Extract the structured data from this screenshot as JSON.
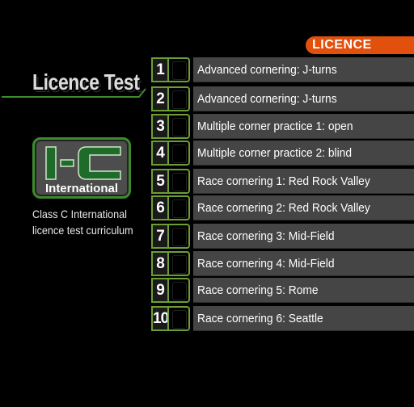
{
  "header": {
    "tab_label": "LICENCE"
  },
  "title": {
    "text": "Licence Test"
  },
  "badge": {
    "letters": "I-C",
    "label": "International"
  },
  "description": "Class C International\nlicence test curriculum",
  "colors": {
    "accent_orange": "#e2500e",
    "accent_green": "#3d8a2e",
    "row_background": "#454545"
  },
  "tests": [
    {
      "number": "1",
      "name": "Advanced cornering: J-turns"
    },
    {
      "number": "2",
      "name": "Advanced cornering: J-turns"
    },
    {
      "number": "3",
      "name": "Multiple corner practice 1: open"
    },
    {
      "number": "4",
      "name": "Multiple corner practice 2: blind"
    },
    {
      "number": "5",
      "name": "Race cornering 1: Red Rock Valley"
    },
    {
      "number": "6",
      "name": "Race cornering 2: Red Rock Valley"
    },
    {
      "number": "7",
      "name": "Race cornering 3: Mid-Field"
    },
    {
      "number": "8",
      "name": "Race cornering 4: Mid-Field"
    },
    {
      "number": "9",
      "name": "Race cornering 5: Rome"
    },
    {
      "number": "10",
      "name": "Race cornering 6: Seattle"
    }
  ]
}
